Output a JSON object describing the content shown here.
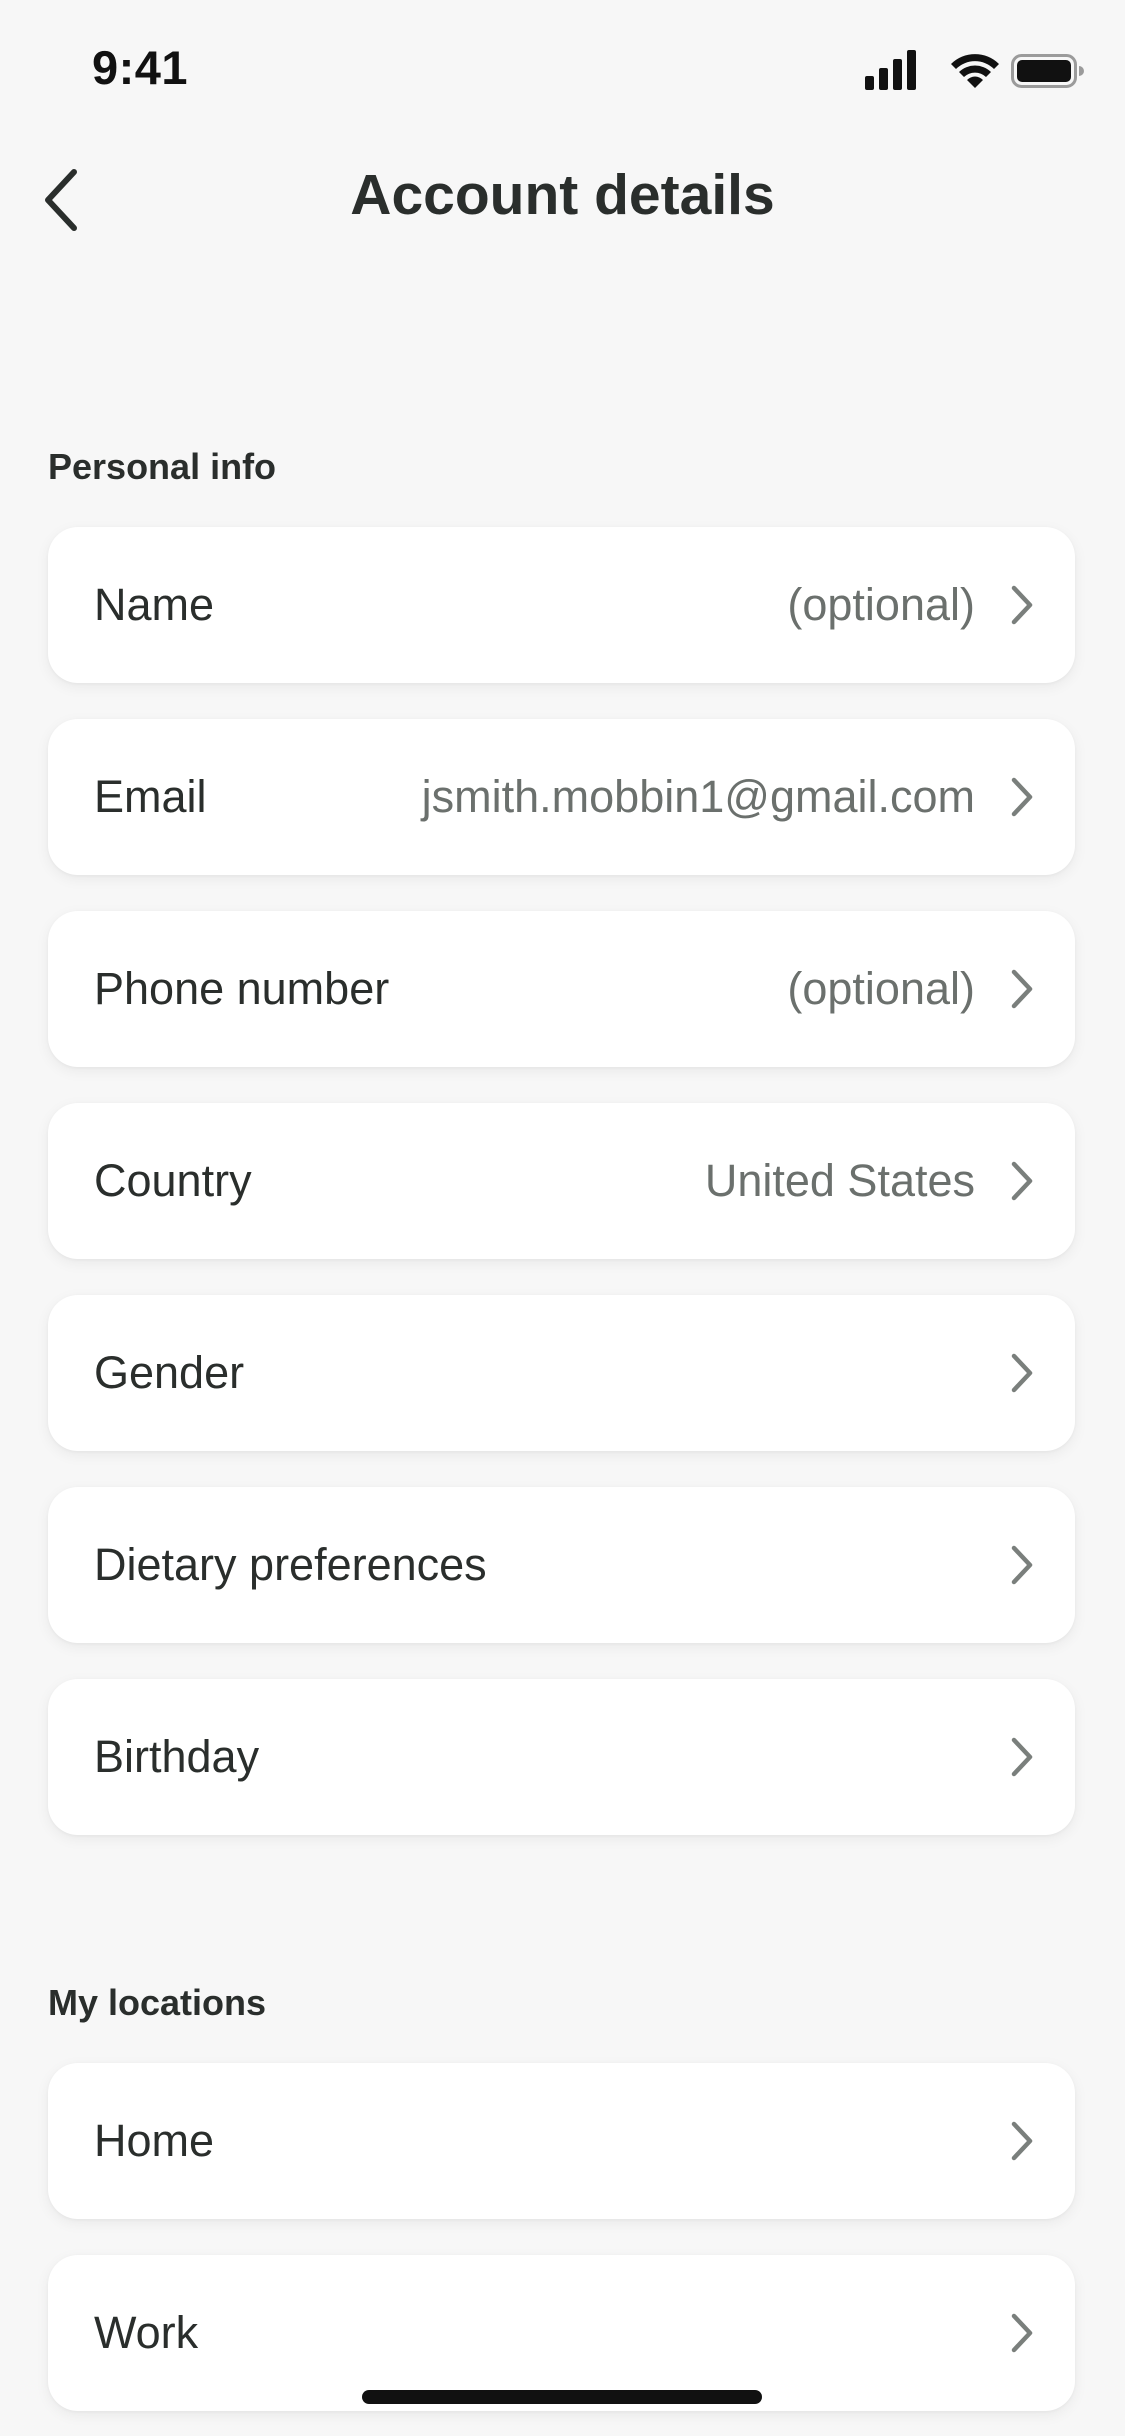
{
  "status_bar": {
    "time": "9:41"
  },
  "nav": {
    "title": "Account details",
    "back_icon": "chevron-left-icon"
  },
  "sections": [
    {
      "title": "Personal info",
      "rows": [
        {
          "label": "Name",
          "value": "(optional)"
        },
        {
          "label": "Email",
          "value": "jsmith.mobbin1@gmail.com"
        },
        {
          "label": "Phone number",
          "value": "(optional)"
        },
        {
          "label": "Country",
          "value": "United States"
        },
        {
          "label": "Gender",
          "value": ""
        },
        {
          "label": "Dietary preferences",
          "value": ""
        },
        {
          "label": "Birthday",
          "value": ""
        }
      ]
    },
    {
      "title": "My locations",
      "rows": [
        {
          "label": "Home",
          "value": ""
        },
        {
          "label": "Work",
          "value": ""
        }
      ]
    }
  ],
  "colors": {
    "background": "#F7F7F7",
    "card": "#FFFFFF",
    "text_primary": "#2A2E2C",
    "text_secondary": "#6B706D",
    "chevron": "#7A7F7C"
  }
}
